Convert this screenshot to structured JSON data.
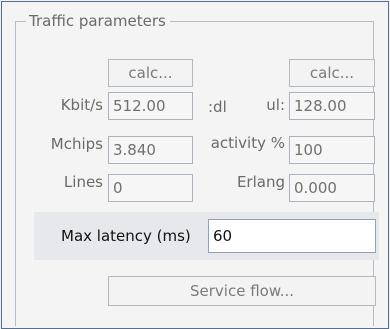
{
  "group": {
    "title": "Traffic parameters"
  },
  "calc_left": {
    "label": "calc..."
  },
  "calc_right": {
    "label": "calc..."
  },
  "rows": {
    "kbits": {
      "label": "Kbit/s",
      "value": "512.00",
      "dl_label": ":dl",
      "ul_label": "ul:",
      "ul_value": "128.00"
    },
    "mchips": {
      "label": "Mchips",
      "value": "3.840",
      "activity_label": "activity %",
      "activity_value": "100"
    },
    "lines": {
      "label": "Lines",
      "value": "0",
      "erlang_label": "Erlang",
      "erlang_value": "0.000"
    }
  },
  "latency": {
    "label": "Max latency  (ms)",
    "value": "60"
  },
  "service_flow": {
    "label": "Service flow..."
  }
}
